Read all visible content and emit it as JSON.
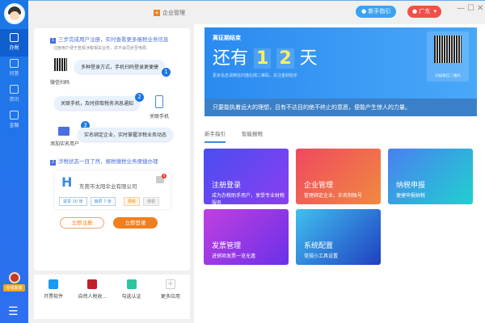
{
  "sidebar": {
    "items": [
      {
        "label": "办税",
        "icon": "tax-icon",
        "active": true
      },
      {
        "label": "问答",
        "icon": "qa-icon"
      },
      {
        "label": "资讯",
        "icon": "news-icon"
      },
      {
        "label": "金融",
        "icon": "finance-icon"
      }
    ],
    "service_label": "在线客服"
  },
  "topbar": {
    "title": "企业管理",
    "guide_label": "新手指引",
    "region_label": "广东",
    "minimize": "—",
    "maximize": "☐",
    "close": "✕"
  },
  "left": {
    "step1_num": "1",
    "step1_title": "三步完成用户注册，实时查看更多报税业务信息",
    "step1_sub": "注册用户便于查看涉税相关业务，并不会同步至电局",
    "bubble1": "多种登录方式，手机扫码登录更便捷",
    "cap1": "微信扫码",
    "bubble2": "关联手机，及时获取税务消息通知",
    "cap2": "关联手机",
    "bubble3": "实名绑定企业，实时掌握涉税业务动态",
    "cap3": "添加实名用户",
    "step2_num": "2",
    "step2_title": "涉税状态一目了然，报税缴税业务便捷办理",
    "company": {
      "letter": "H",
      "name": "东莞市太阳伞业有限公司",
      "badge_count": "4",
      "chip1": "进票 10 张",
      "chip2": "销项 7 张",
      "chip3": "报税",
      "chip4": "缴税"
    },
    "register_label": "立即注册",
    "login_label": "立即登录"
  },
  "apps": [
    {
      "label": "开票软件",
      "color": "#1a9af0"
    },
    {
      "label": "自然人税收...",
      "color": "#c0202a"
    },
    {
      "label": "勾选认证",
      "color": "#2ec4a0"
    },
    {
      "label": "更多应用",
      "color": "#ccc"
    }
  ],
  "banner": {
    "title": "离征期结束",
    "prefix": "还有",
    "d1": "1",
    "d2": "2",
    "suffix": "天",
    "desc": "更多信息请微信扫描右侧二维码，关注金财助手",
    "qr_caption": "扫描微信二维码",
    "quote": "只要能执着远大的理想，且有不达目的绝不终止的意愿，便能产生惊人的力量。"
  },
  "tabs": [
    {
      "label": "新手指引",
      "active": true
    },
    {
      "label": "智能报税"
    }
  ],
  "cards": [
    {
      "title": "注册登录",
      "sub": "成为办税助手用户，享受专业财税服务"
    },
    {
      "title": "企业管理",
      "sub": "管理绑定企业，实名制账号"
    },
    {
      "title": "纳税申报",
      "sub": "便捷申报纳税"
    },
    {
      "title": "发票管理",
      "sub": "进销项发票一览无遗"
    },
    {
      "title": "系统配置",
      "sub": "常规小工具设置"
    }
  ],
  "colors": {
    "sidebar": "#1a78e6",
    "accent_orange": "#f07f20",
    "banner_blue": "#2a8af0"
  }
}
